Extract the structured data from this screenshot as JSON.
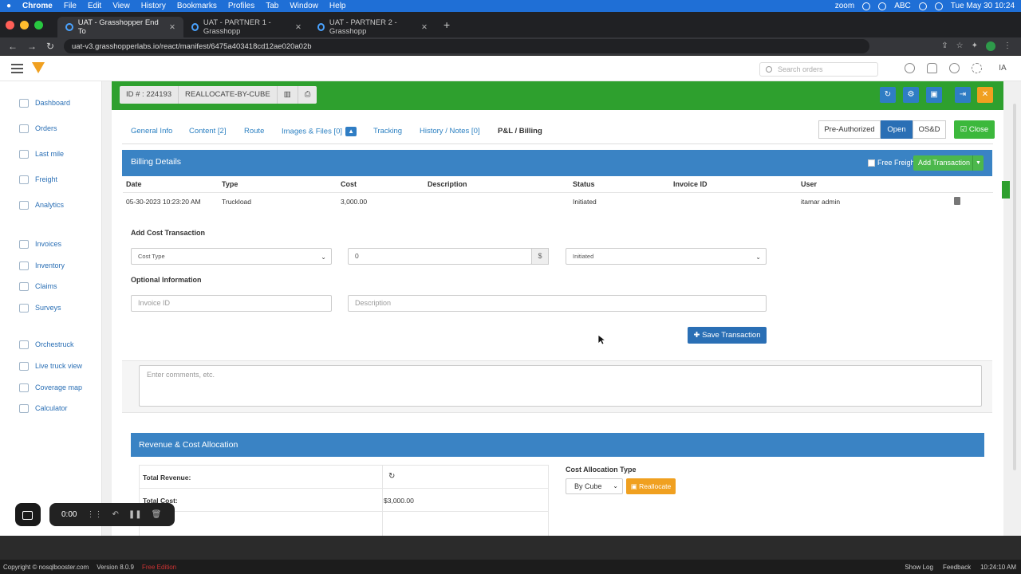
{
  "macbar": {
    "menus": [
      "Chrome",
      "File",
      "Edit",
      "View",
      "History",
      "Bookmarks",
      "Profiles",
      "Tab",
      "Window",
      "Help"
    ],
    "zoom": "zoom",
    "keyboard": "ABC",
    "datetime": "Tue May 30  10:24"
  },
  "browser": {
    "tabs": [
      {
        "title": "UAT - Grasshopper End To"
      },
      {
        "title": "UAT - PARTNER 1 - Grasshopp"
      },
      {
        "title": "UAT - PARTNER 2 - Grasshopp"
      }
    ],
    "url": "uat-v3.grasshopperlabs.io/react/manifest/6475a403418cd12ae020a02b"
  },
  "header": {
    "search_placeholder": "Search orders",
    "user_initials": "IA"
  },
  "sidebar": {
    "items": [
      {
        "label": "Dashboard"
      },
      {
        "label": "Orders"
      },
      {
        "label": "Last mile"
      },
      {
        "label": "Freight"
      },
      {
        "label": "Analytics"
      },
      {
        "label": "Invoices"
      },
      {
        "label": "Inventory"
      },
      {
        "label": "Claims"
      },
      {
        "label": "Surveys"
      },
      {
        "label": "Orchestruck"
      },
      {
        "label": "Live truck view"
      },
      {
        "label": "Coverage map"
      },
      {
        "label": "Calculator"
      }
    ]
  },
  "manifest": {
    "id_label": "ID # : 224193",
    "name": "REALLOCATE-BY-CUBE"
  },
  "tabs": {
    "items": [
      {
        "label": "General Info"
      },
      {
        "label": "Content [2]"
      },
      {
        "label": "Route"
      },
      {
        "label": "Images & Files [0]"
      },
      {
        "label": "Tracking"
      },
      {
        "label": "History / Notes [0]"
      },
      {
        "label": "P&L / Billing"
      }
    ]
  },
  "status_buttons": {
    "pre_authorized": "Pre-Authorized",
    "open": "Open",
    "osd": "OS&D",
    "close": "Close"
  },
  "billing": {
    "title": "Billing Details",
    "free_freight": "Free Freight",
    "add_transaction": "Add Transaction",
    "columns": [
      "Date",
      "Type",
      "Cost",
      "Description",
      "Status",
      "Invoice ID",
      "User"
    ],
    "rows": [
      {
        "date": "05-30-2023 10:23:20 AM",
        "type": "Truckload",
        "cost": "3,000.00",
        "description": "",
        "status": "Initiated",
        "invoice_id": "",
        "user": "itamar admin"
      }
    ],
    "add_cost_title": "Add Cost Transaction",
    "cost_type": "Cost Type",
    "cost_value": "0",
    "currency": "$",
    "status_value": "Initiated",
    "optional_title": "Optional Information",
    "invoice_placeholder": "Invoice ID",
    "description_placeholder": "Description",
    "save_label": "Save Transaction",
    "comments_placeholder": "Enter comments, etc."
  },
  "revenue": {
    "title": "Revenue & Cost Allocation",
    "total_revenue_label": "Total Revenue:",
    "total_cost_label": "Total Cost:",
    "total_cost_value": "$3,000.00",
    "cost_allocation_type_label": "Cost Allocation Type",
    "cost_allocation_type_value": "By Cube",
    "reallocate_label": "Reallocate"
  },
  "recorder": {
    "time": "0:00"
  },
  "statusbar": {
    "copyright": "Copyright ©  nosqlbooster.com",
    "version": "Version 8.0.9",
    "edition": "Free Edition",
    "show_log": "Show Log",
    "feedback": "Feedback",
    "time": "10:24:10 AM"
  }
}
